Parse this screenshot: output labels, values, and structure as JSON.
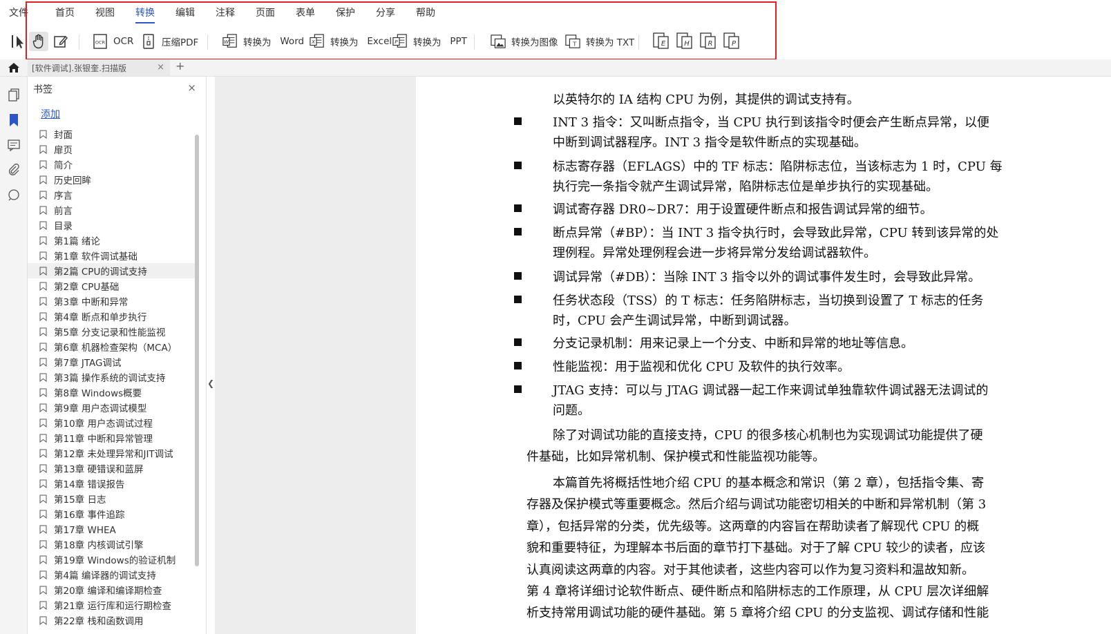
{
  "menu": {
    "file": "文件",
    "tabs": [
      "首页",
      "视图",
      "转换",
      "编辑",
      "注释",
      "页面",
      "表单",
      "保护",
      "分享",
      "帮助"
    ],
    "active_index": 2
  },
  "toolbar": {
    "ocr": "OCR",
    "compress": "压缩PDF",
    "to_word_prefix": "转换为",
    "to_word": "Word",
    "to_excel_prefix": "转换为",
    "to_excel": "Excel",
    "to_ppt_prefix": "转换为",
    "to_ppt": "PPT",
    "to_image": "转换为图像",
    "to_txt": "转换为 TXT",
    "fmt_letters": [
      "E",
      "H",
      "R",
      "P"
    ]
  },
  "tab": {
    "title": "[软件调试].张银奎.扫描版",
    "close": "×",
    "new": "+"
  },
  "panel": {
    "title": "书签",
    "close": "×",
    "add": "添加",
    "items": [
      "封面",
      "扉页",
      "简介",
      "历史回眸",
      "序言",
      "前言",
      "目录",
      "第1篇 绪论",
      "第1章 软件调试基础",
      "第2篇 CPU的调试支持",
      "第2章 CPU基础",
      "第3章 中断和异常",
      "第4章 断点和单步执行",
      "第5章 分支记录和性能监视",
      "第6章 机器检查架构（MCA）",
      "第7章 JTAG调试",
      "第3篇 操作系统的调试支持",
      "第8章 Windows概要",
      "第9章 用户态调试模型",
      "第10章 用户态调试过程",
      "第11章 中断和异常管理",
      "第12章 未处理异常和JIT调试",
      "第13章 硬错误和蓝屏",
      "第14章 错误报告",
      "第15章 日志",
      "第16章 事件追踪",
      "第17章 WHEA",
      "第18章 内核调试引擎",
      "第19章 Windows的验证机制",
      "第4篇 编译器的调试支持",
      "第20章 编译和编译期检查",
      "第21章 运行库和运行期检查",
      "第22章 栈和函数调用"
    ],
    "selected_index": 9
  },
  "document": {
    "intro": "以英特尔的 IA 结构 CPU 为例，其提供的调试支持有。",
    "bullets": [
      [
        "INT 3 指令：又叫断点指令，当 CPU 执行到该指令时便会产生断点异常，以便",
        "中断到调试器程序。INT 3 指令是软件断点的实现基础。"
      ],
      [
        "标志寄存器（EFLAGS）中的 TF 标志：陷阱标志位，当该标志为 1 时，CPU 每",
        "执行完一条指令就产生调试异常，陷阱标志位是单步执行的实现基础。"
      ],
      [
        "调试寄存器 DR0~DR7：用于设置硬件断点和报告调试异常的细节。"
      ],
      [
        "断点异常（#BP）：当 INT 3 指令执行时，会导致此异常，CPU 转到该异常的处",
        "理例程。异常处理例程会进一步将异常分发给调试器软件。"
      ],
      [
        "调试异常（#DB）：当除 INT 3 指令以外的调试事件发生时，会导致此异常。"
      ],
      [
        "任务状态段（TSS）的 T 标志：任务陷阱标志，当切换到设置了 T 标志的任务",
        "时，CPU 会产生调试异常，中断到调试器。"
      ],
      [
        "分支记录机制：用来记录上一个分支、中断和异常的地址等信息。"
      ],
      [
        "性能监视：用于监视和优化 CPU 及软件的执行效率。"
      ],
      [
        "JTAG 支持：可以与 JTAG 调试器一起工作来调试单独靠软件调试器无法调试的",
        "问题。"
      ]
    ],
    "para1": [
      "除了对调试功能的直接支持，CPU 的很多核心机制也为实现调试功能提供了硬",
      "件基础，比如异常机制、保护模式和性能监视功能等。"
    ],
    "para2": [
      "本篇首先将概括性地介绍 CPU 的基本概念和常识（第 2 章），包括指令集、寄",
      "存器及保护模式等重要概念。然后介绍与调试功能密切相关的中断和异常机制（第 3",
      "章），包括异常的分类，优先级等。这两章的内容旨在帮助读者了解现代 CPU 的概",
      "貌和重要特征，为理解本书后面的章节打下基础。对于了解 CPU 较少的读者，应该",
      "认真阅读这两章的内容。对于其他读者，这些内容可以作为复习资料和温故知新。",
      "第 4 章将详细讨论软件断点、硬件断点和陷阱标志的工作原理，从 CPU 层次详细解",
      "析支持常用调试功能的硬件基础。第 5 章将介绍 CPU 的分支监视、调试存储和性能"
    ]
  }
}
